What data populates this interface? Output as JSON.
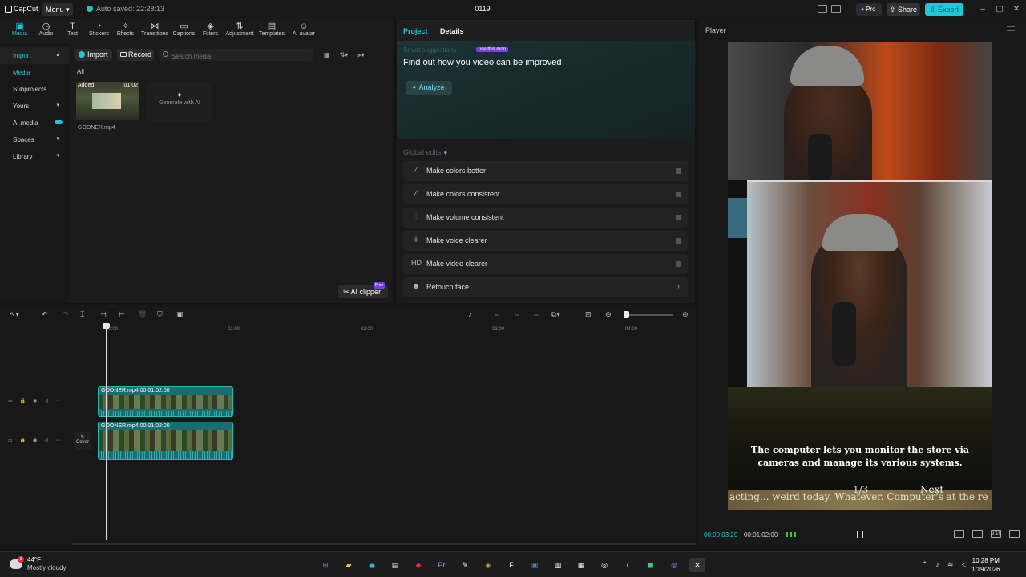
{
  "app": {
    "logo": "CapCut",
    "menu": "Menu",
    "autosave": "Auto saved: 22:28:13",
    "project_title": "0119",
    "pro": "Pro",
    "share": "Share",
    "export": "Export"
  },
  "toolbar": {
    "items": [
      "Media",
      "Audio",
      "Text",
      "Stickers",
      "Effects",
      "Transitions",
      "Captions",
      "Filters",
      "Adjustment",
      "Templates",
      "AI avatar"
    ]
  },
  "sidebar": {
    "items": [
      "Import",
      "Media",
      "Subprojects",
      "Yours",
      "AI media",
      "Spaces",
      "Library"
    ]
  },
  "media": {
    "import": "Import",
    "record": "Record",
    "search_placeholder": "Search media",
    "filter_all": "All",
    "clip": {
      "added": "Added",
      "duration": "01:02",
      "name": "GOONER.mp4"
    },
    "generate_ai": "Generate with AI",
    "ai_clipper": "AI clipper",
    "free_tag": "Free"
  },
  "details": {
    "tab_project": "Project",
    "tab_details": "Details",
    "smart_title": "Smart suggestions",
    "use_badge": "use this mon",
    "improve_text": "Find out how you video can be improved",
    "analyze": "Analyze",
    "global_edits": "Global edits",
    "edits": [
      "Make colors better",
      "Make colors consistent",
      "Make volume consistent",
      "Make voice clearer",
      "Make video clearer",
      "Retouch face"
    ]
  },
  "player": {
    "title": "Player",
    "game_text": "The computer lets you monitor the store via cameras and manage its various systems.",
    "page": "1/3",
    "next": "Next",
    "scroll_text": "acting... weird today. Whatever. Computer's at the re",
    "current_time": "00:00:03:29",
    "total_time": "00:01:02:00",
    "ratio": "9:16"
  },
  "timeline": {
    "ticks": [
      "00:00",
      "01:00",
      "02:00",
      "03:00",
      "04:00"
    ],
    "clips": [
      {
        "label": "GOONER.mp4  00:01:02:00"
      },
      {
        "label": "GOONER.mp4  00:01:02:00"
      }
    ],
    "cover": "Cover"
  },
  "taskbar": {
    "badge": "3",
    "temperature": "44°F",
    "condition": "Mostly cloudy",
    "time": "10:28 PM",
    "date": "1/19/2026"
  }
}
